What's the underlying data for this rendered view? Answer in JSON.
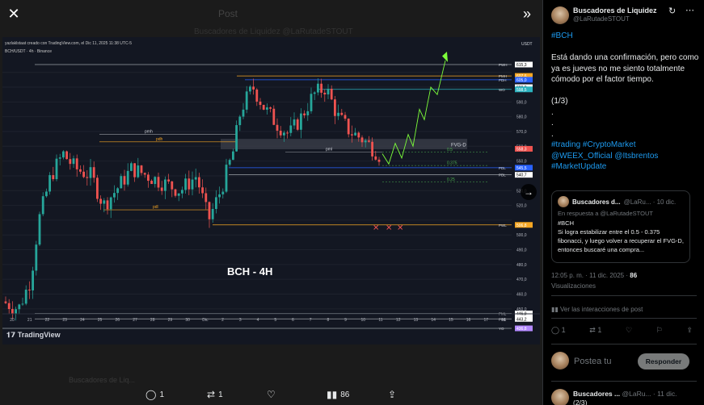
{
  "viewer": {
    "close_icon": "close-icon",
    "collapse_icon": "chevrons-right-icon",
    "ghost_post_label": "Post",
    "ghost_text": "Buscadores de Liquidez @LaRutadeSTOUT",
    "ghost_author": "Buscadores de Liq..."
  },
  "chart": {
    "header": "yazlaklstaat creado con TradingView.com, el Dic 11, 2025 11:38 UTC-5",
    "symbol": "BCH/USDT · 4h · Binance",
    "currency": "USDT",
    "overlay_title": "BCH - 4H",
    "brand": "TradingView",
    "labels": {
      "fvg": "FVG-D",
      "pmh": "pmh",
      "pdh": "pdh",
      "pdl": "pdl",
      "pml": "pml",
      "fib_05": "0.5",
      "fib_0375": "0.375",
      "fib_025": "0.25"
    },
    "price_axis": [
      {
        "label": "PWH",
        "value": "615,3",
        "color": "#ffffff"
      },
      {
        "label": "PMH",
        "value": "607,6",
        "color": "#f5a623"
      },
      {
        "label": "PDH",
        "value": "605,0",
        "color": "#2962ff"
      },
      {
        "label": "",
        "value": "600,0",
        "color": "#ffffff"
      },
      {
        "label": "WO",
        "value": "598,5",
        "color": "#2bb3c0"
      },
      {
        "label": "",
        "value": "590,0",
        "color": ""
      },
      {
        "label": "",
        "value": "580,0",
        "color": ""
      },
      {
        "label": "",
        "value": "570,0",
        "color": ""
      },
      {
        "label": "",
        "value": "560,0",
        "color": ""
      },
      {
        "label": "",
        "value": "558,3",
        "color": "#ef5350"
      },
      {
        "label": "",
        "value": "550,0",
        "color": ""
      },
      {
        "label": "PDL",
        "value": "545,5",
        "color": "#2962ff"
      },
      {
        "label": "PDL",
        "value": "540,7",
        "color": "#ffffff"
      },
      {
        "label": "",
        "value": "530,0",
        "color": ""
      },
      {
        "label": "",
        "value": "520,0",
        "color": ""
      },
      {
        "label": "PWL",
        "value": "506,8",
        "color": "#f5a623"
      },
      {
        "label": "",
        "value": "500,0",
        "color": ""
      },
      {
        "label": "",
        "value": "490,0",
        "color": ""
      },
      {
        "label": "",
        "value": "480,0",
        "color": ""
      },
      {
        "label": "",
        "value": "470,0",
        "color": ""
      },
      {
        "label": "",
        "value": "460,0",
        "color": ""
      },
      {
        "label": "",
        "value": "450,0",
        "color": ""
      },
      {
        "label": "PML",
        "value": "446,9",
        "color": "#ffffff"
      },
      {
        "label": "PML",
        "value": "443,2",
        "color": "#ffffff"
      },
      {
        "label": "YO",
        "value": "436,8",
        "color": "#b388ff"
      }
    ],
    "time_axis": [
      "20",
      "21",
      "22",
      "23",
      "24",
      "25",
      "26",
      "27",
      "28",
      "29",
      "30",
      "Dic",
      "2",
      "3",
      "4",
      "5",
      "6",
      "7",
      "8",
      "9",
      "10",
      "11",
      "12",
      "13",
      "14",
      "15",
      "16",
      "17",
      "18"
    ]
  },
  "viewer_actions": {
    "replies": "1",
    "reposts": "1",
    "views": "86"
  },
  "post": {
    "author_name": "Buscadores de Liquidez",
    "author_handle": "@LaRutadeSTOUT",
    "body": [
      {
        "text": "#BCH",
        "link": true
      },
      {
        "text": "",
        "link": false
      },
      {
        "text": "Está dando una confirmación, pero como ya es jueves no me siento totalmente cómodo por el factor tiempo.",
        "link": false
      },
      {
        "text": "",
        "link": false
      },
      {
        "text": "(1/3)",
        "link": false
      },
      {
        "text": ".",
        "link": false
      },
      {
        "text": ".",
        "link": false
      },
      {
        "text": ".",
        "link": false
      }
    ],
    "hashtags_line1": "#trading #CryptoMarket",
    "hashtags_line2": "@WEEX_Official @Itsbrentos",
    "hashtags_line3": "#MarketUpdate",
    "quote": {
      "name": "Buscadores d...",
      "meta": "@LaRu... · 10 dic.",
      "reply_to": "En respuesta a @LaRutadeSTOUT",
      "text": "#BCH\nSi logra estabilizar entre el 0.5 - 0.375 fibonacci, y luego volver a recuperar el FVG-D, entonces buscaré una compra..."
    },
    "time": "12:05 p. m. · 11 dic. 2025 ·",
    "views_count": "86",
    "views_label": "Visualizaciones",
    "interactions_label": "Ver las interacciones de post",
    "replies": "1",
    "reposts": "1",
    "reply_placeholder": "Postea tu",
    "reply_button": "Responder",
    "next_name": "Buscadores ...",
    "next_meta": "@LaRu... · 11 dic.",
    "next_text": "(2/3)"
  }
}
